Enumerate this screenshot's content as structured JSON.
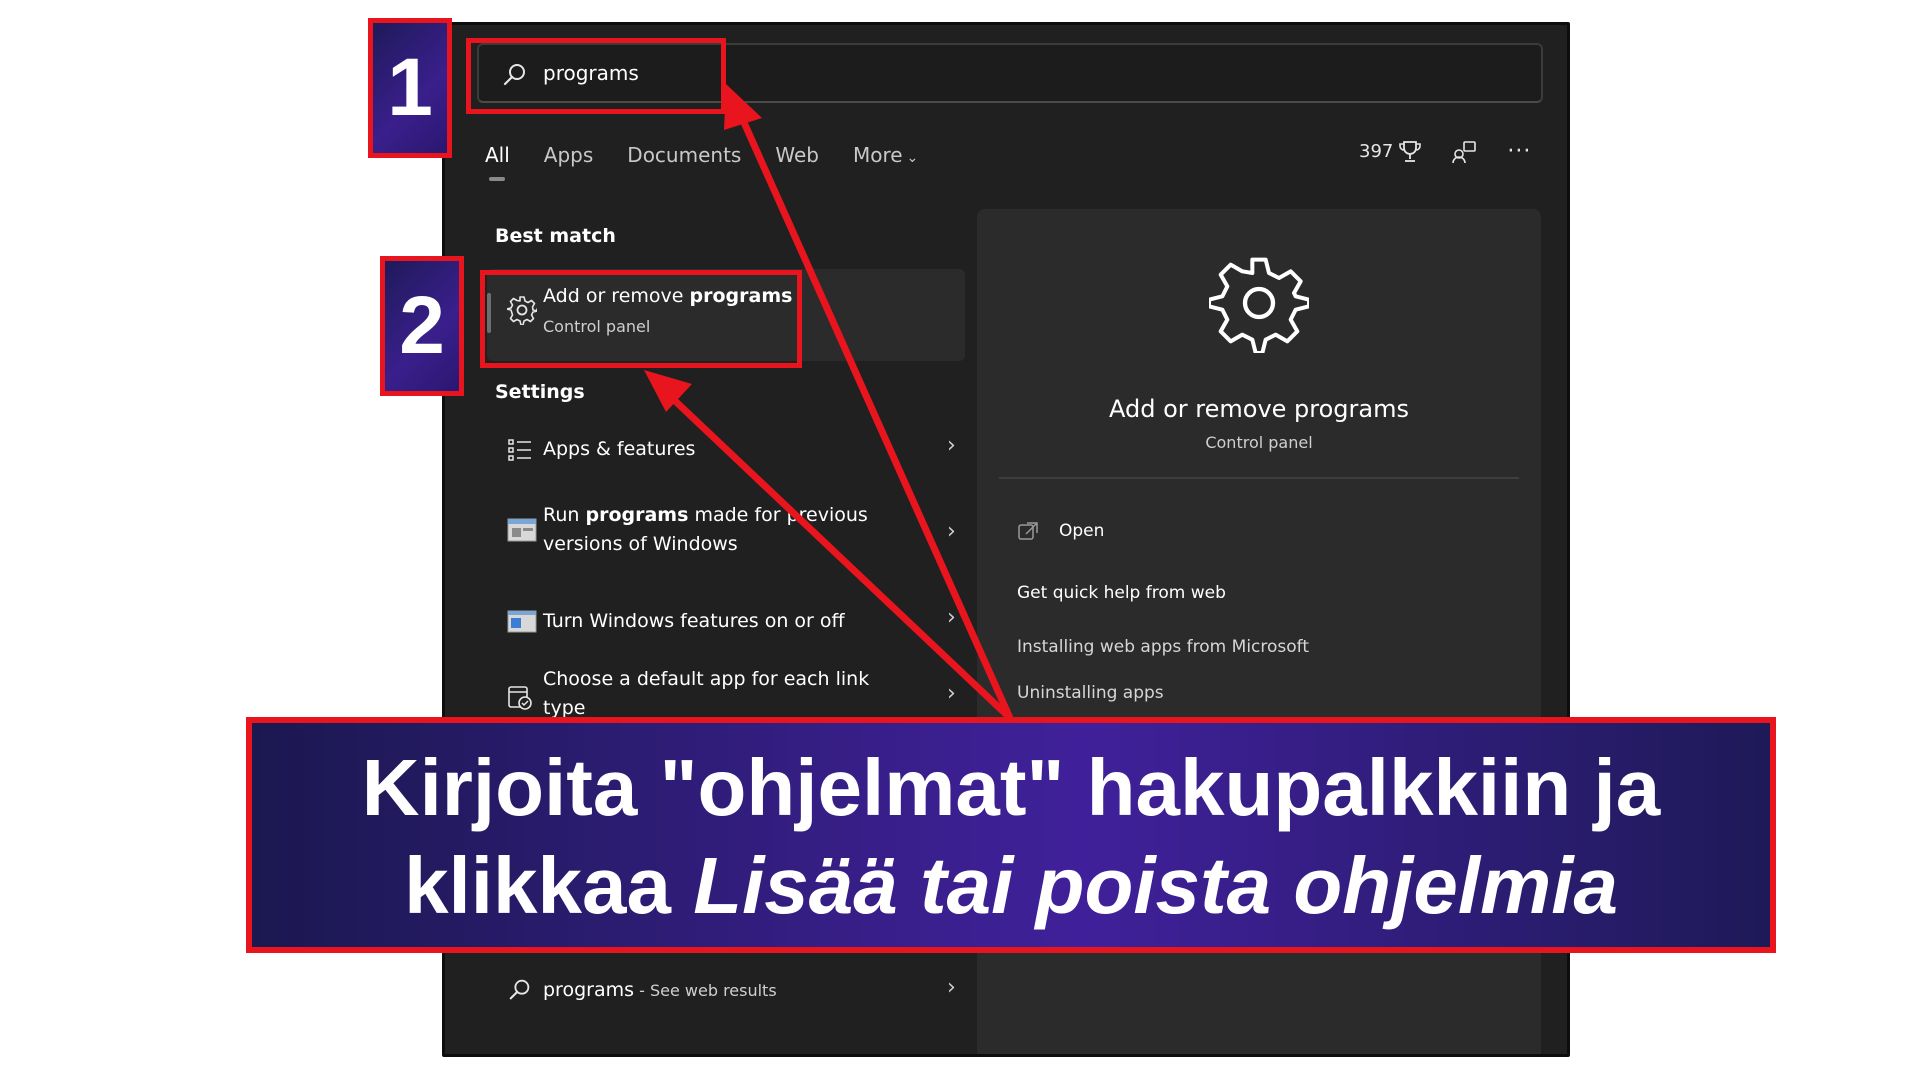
{
  "search": {
    "value": "programs"
  },
  "tabs": [
    {
      "label": "All",
      "active": true
    },
    {
      "label": "Apps",
      "active": false
    },
    {
      "label": "Documents",
      "active": false
    },
    {
      "label": "Web",
      "active": false
    },
    {
      "label": "More",
      "active": false
    }
  ],
  "toolbar": {
    "points": "397",
    "more_glyph": "···"
  },
  "best_match": {
    "heading": "Best match",
    "title_prefix": "Add or remove ",
    "title_bold": "programs",
    "subtitle": "Control panel"
  },
  "settings": {
    "heading": "Settings",
    "items": [
      {
        "pre": "Apps & features",
        "bold": "",
        "post": ""
      },
      {
        "pre": "Run ",
        "bold": "programs",
        "post": " made for previous versions of Windows"
      },
      {
        "pre": "Turn Windows features on or off",
        "bold": "",
        "post": ""
      },
      {
        "pre": "Choose a default app for each link type",
        "bold": "",
        "post": ""
      }
    ]
  },
  "detail": {
    "title": "Add or remove programs",
    "subtitle": "Control panel",
    "open_label": "Open",
    "help_heading": "Get quick help from web",
    "links": [
      "Installing web apps from Microsoft",
      "Uninstalling apps"
    ]
  },
  "web_search": {
    "term": "programs",
    "suffix": " - See web results"
  },
  "annotations": {
    "step1": "1",
    "step2": "2",
    "caption_line1": "Kirjoita \"ohjelmat\" hakupalkkiin ja",
    "caption_line2_normal": "klikkaa ",
    "caption_line2_italic": "Lisää tai poista ohjelmia"
  },
  "colors": {
    "highlight": "#e8141e",
    "panel_bg": "#202020",
    "card_bg": "#2b2b2b",
    "badge_bg": "#3a1f8c"
  }
}
